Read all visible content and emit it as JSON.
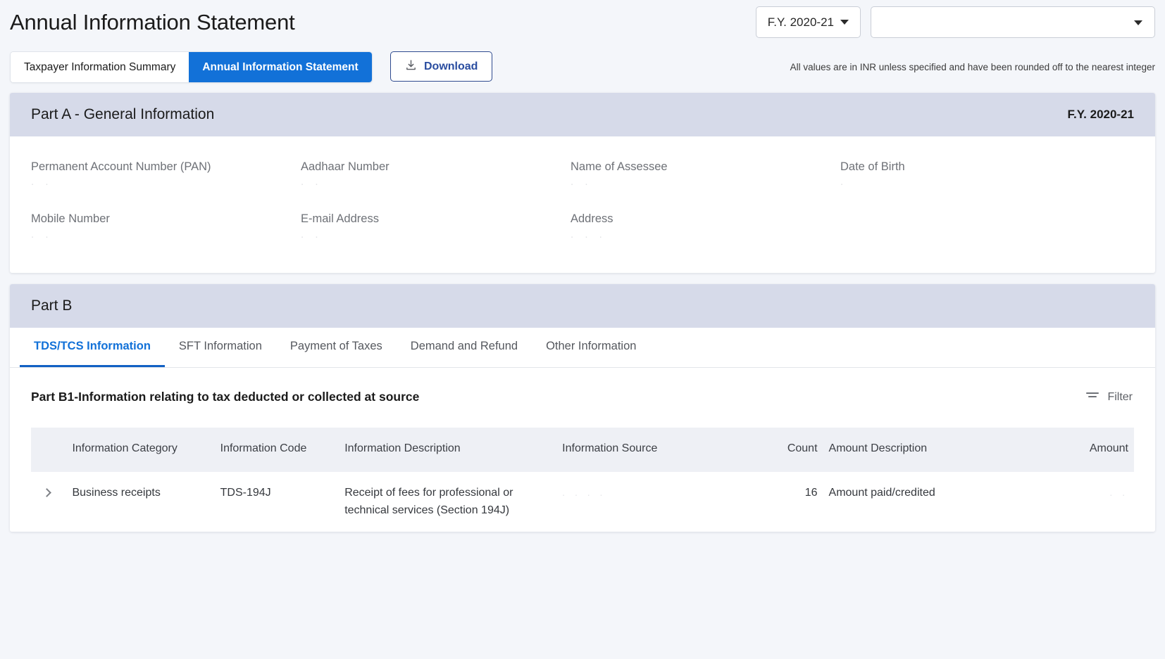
{
  "header": {
    "title": "Annual Information Statement",
    "fy_select": {
      "label": "F.Y. 2020-21",
      "icon": "chevron-down-icon"
    },
    "secondary_select": {
      "value": "",
      "icon": "chevron-down-icon"
    }
  },
  "toolbar": {
    "segments": [
      {
        "label": "Taxpayer Information Summary",
        "active": false
      },
      {
        "label": "Annual Information Statement",
        "active": true
      }
    ],
    "download": {
      "label": "Download",
      "icon": "download-icon"
    },
    "note": "All values are in INR unless specified and have been rounded off to the nearest integer"
  },
  "part_a": {
    "heading": "Part A - General Information",
    "fy_tag": "F.Y. 2020-21",
    "fields": [
      {
        "label": "Permanent Account Number (PAN)",
        "value": ""
      },
      {
        "label": "Aadhaar Number",
        "value": ""
      },
      {
        "label": "Name of Assessee",
        "value": ""
      },
      {
        "label": "Date of Birth",
        "value": ""
      },
      {
        "label": "Mobile Number",
        "value": ""
      },
      {
        "label": "E-mail Address",
        "value": ""
      },
      {
        "label": "Address",
        "value": ""
      }
    ]
  },
  "part_b": {
    "heading": "Part B",
    "tabs": [
      {
        "label": "TDS/TCS Information",
        "active": true
      },
      {
        "label": "SFT Information",
        "active": false
      },
      {
        "label": "Payment of Taxes",
        "active": false
      },
      {
        "label": "Demand and Refund",
        "active": false
      },
      {
        "label": "Other Information",
        "active": false
      }
    ],
    "section": {
      "title": "Part B1-Information relating to tax deducted or collected at source",
      "filter": {
        "label": "Filter",
        "icon": "filter-icon"
      },
      "columns": [
        "Information Category",
        "Information Code",
        "Information Description",
        "Information Source",
        "Count",
        "Amount Description",
        "Amount"
      ],
      "rows": [
        {
          "expand_icon": "chevron-right-icon",
          "category": "Business receipts",
          "code": "TDS-194J",
          "description": "Receipt of fees for professional or technical services (Section 194J)",
          "source": "",
          "count": "16",
          "amount_description": "Amount paid/credited",
          "amount": ""
        }
      ]
    }
  },
  "colors": {
    "accent_blue": "#1271d8",
    "card_header": "#d6dae9",
    "page_bg": "#f4f6fa",
    "download_border": "#2f4b8f"
  }
}
